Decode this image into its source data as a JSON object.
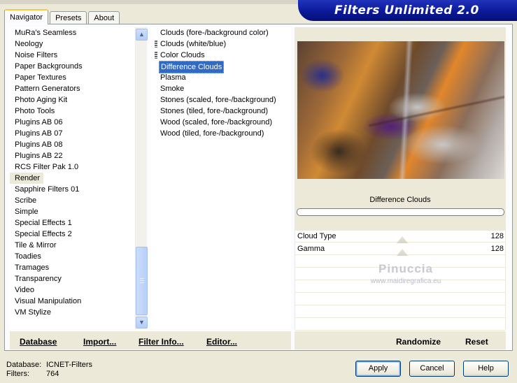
{
  "window": {
    "banner_title": "Filters Unlimited 2.0"
  },
  "tabs": [
    {
      "label": "Navigator",
      "active": true
    },
    {
      "label": "Presets",
      "active": false
    },
    {
      "label": "About",
      "active": false
    }
  ],
  "categories": {
    "items": [
      "MuRa's Seamless",
      "Neology",
      "Noise Filters",
      "Paper Backgrounds",
      "Paper Textures",
      "Pattern Generators",
      "Photo Aging Kit",
      "Photo Tools",
      "Plugins AB 06",
      "Plugins AB 07",
      "Plugins AB 08",
      "Plugins AB 22",
      "RCS Filter Pak 1.0",
      "Render",
      "Sapphire Filters 01",
      "Scribe",
      "Simple",
      "Special Effects 1",
      "Special Effects 2",
      "Tile & Mirror",
      "Toadies",
      "Tramages",
      "Transparency",
      "Video",
      "Visual Manipulation",
      "VM Stylize"
    ],
    "selected": "Render"
  },
  "filters": {
    "items": [
      "Clouds (fore-/background color)",
      "Clouds (white/blue)",
      "Color Clouds",
      "Difference Clouds",
      "Plasma",
      "Smoke",
      "Stones (scaled, fore-/background)",
      "Stones (tiled, fore-/background)",
      "Wood (scaled, fore-/background)",
      "Wood (tiled, fore-/background)"
    ],
    "selected": "Difference Clouds"
  },
  "preview": {
    "filter_name": "Difference Clouds",
    "watermark": "Pinuccia",
    "watermark_url": "www.maidiregrafica.eu"
  },
  "params": [
    {
      "label": "Cloud Type",
      "value": "128"
    },
    {
      "label": "Gamma",
      "value": "128"
    }
  ],
  "toolbar": {
    "database": "Database",
    "import": "Import...",
    "filter_info": "Filter Info...",
    "editor": "Editor...",
    "randomize": "Randomize",
    "reset": "Reset"
  },
  "footer": {
    "database_key": "Database:",
    "database_value": "ICNET-Filters",
    "filters_key": "Filters:",
    "filters_value": "764"
  },
  "buttons": {
    "apply": "Apply",
    "cancel": "Cancel",
    "help": "Help"
  },
  "colors": {
    "selection": "#316ac5",
    "banner": "#0a1a99",
    "tab_highlight": "#ffc83c"
  }
}
